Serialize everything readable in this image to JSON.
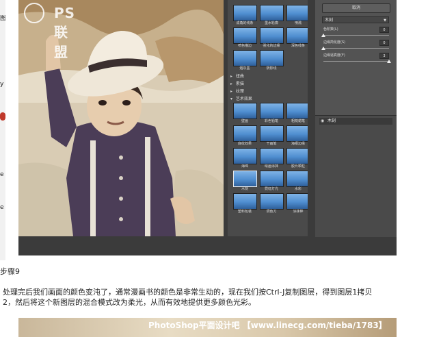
{
  "page": {
    "step_heading": "步骤9",
    "paragraph_line1": "处理完后我们画面的颜色变沌了，通常漫画书的颜色是非常生动的，现在我们按Ctrl-J复制图层，得到图层1拷贝",
    "paragraph_line2": "2，然后将这个新图层的混合模式改为柔光，从而有效地提供更多颜色光彩。",
    "banner_text": "PhotoShop平面设计吧 【www.linecg.com/tieba/1783】"
  },
  "canvas": {
    "watermark": "PS联盟"
  },
  "gallery": {
    "top_filters": [
      {
        "label": "成角的线条"
      },
      {
        "label": "墨水轮廓"
      },
      {
        "label": "喷溅"
      },
      {
        "label": "喷色描边"
      },
      {
        "label": "强化的边缘"
      },
      {
        "label": "深色线条"
      },
      {
        "label": "烟灰墨"
      },
      {
        "label": "阴影线"
      }
    ],
    "categories": [
      {
        "name": "扭曲",
        "expanded": false
      },
      {
        "name": "素描",
        "expanded": false
      },
      {
        "name": "纹理",
        "expanded": false
      },
      {
        "name": "艺术效果",
        "expanded": true
      }
    ],
    "art_filters": [
      {
        "label": "壁画",
        "selected": false
      },
      {
        "label": "彩色铅笔",
        "selected": false
      },
      {
        "label": "粗糙蜡笔",
        "selected": false
      },
      {
        "label": "底纹效果",
        "selected": false
      },
      {
        "label": "干画笔",
        "selected": false
      },
      {
        "label": "海报边缘",
        "selected": false
      },
      {
        "label": "海绵",
        "selected": false
      },
      {
        "label": "绘画涂抹",
        "selected": false
      },
      {
        "label": "胶片颗粒",
        "selected": false
      },
      {
        "label": "木刻",
        "selected": true
      },
      {
        "label": "霓虹灯光",
        "selected": false
      },
      {
        "label": "水彩",
        "selected": false
      },
      {
        "label": "塑料包装",
        "selected": false
      },
      {
        "label": "调色刀",
        "selected": false
      },
      {
        "label": "涂抹棒",
        "selected": false
      }
    ]
  },
  "settings": {
    "ok_label": "取消",
    "filter_select": "木刻",
    "params": [
      {
        "label": "色阶数(L)",
        "value": "0",
        "fraction": 0.0
      },
      {
        "label": "边缘简化度(S)",
        "value": "0",
        "fraction": 0.0
      },
      {
        "label": "边缘逼真度(F)",
        "value": "3",
        "fraction": 1.0
      }
    ],
    "layer_name": "木刻",
    "eye_icon": "eye-icon"
  },
  "colors": {
    "panel_dark": "#3b3b3b",
    "panel_mid": "#4a4a4a",
    "thumb_sky": "#4f8ed0"
  }
}
